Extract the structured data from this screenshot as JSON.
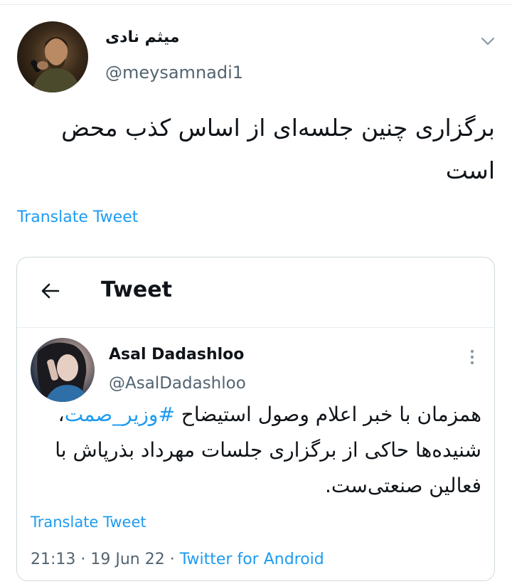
{
  "tweet": {
    "display_name": "میثم نادی",
    "handle": "@meysamnadi1",
    "text": "برگزاری چنین جلسه‌ای از اساس کذب محض است",
    "translate_label": "Translate Tweet"
  },
  "quote": {
    "header_title": "Tweet",
    "display_name": "Asal Dadashloo",
    "handle": "@AsalDadashloo",
    "text_part1": "همزمان با خبر اعلام وصول استیضاح ",
    "hashtag": "#وزیر_صمت",
    "text_part2": "، شنیده‌ها حاکی از برگزاری جلسات مهرداد بذرپاش با فعالین صنعتی‌ست.",
    "translate_label": "Translate Tweet",
    "time": "21:13",
    "date": "19 Jun 22",
    "separator": " · ",
    "source": "Twitter for Android"
  },
  "icons": {
    "menu": "chevron-down-icon",
    "back": "arrow-left-icon",
    "more": "more-vertical-icon"
  },
  "colors": {
    "accent": "#1d9bf0",
    "text": "#0f1419",
    "muted": "#536471",
    "border": "#cfd9de"
  }
}
